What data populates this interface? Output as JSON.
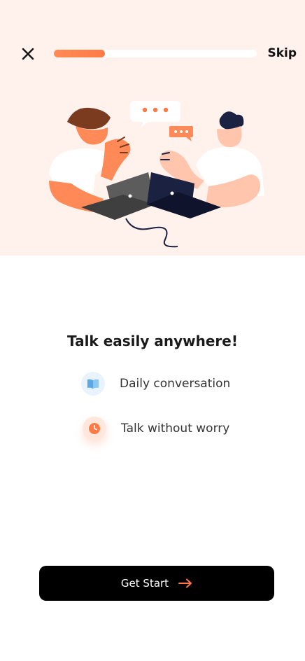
{
  "header": {
    "skip_label": "Skip",
    "progress": 0.25,
    "accent_color": "#ff7a45"
  },
  "main": {
    "title": "Talk easily anywhere!",
    "features": [
      {
        "label": "Daily conversation",
        "icon": "book-icon",
        "icon_bg": "#e8f3fd"
      },
      {
        "label": "Talk without worry",
        "icon": "clock-icon",
        "icon_bg": "#ffe7dc"
      }
    ]
  },
  "cta": {
    "label": "Get Start",
    "icon": "arrow-right-icon"
  }
}
